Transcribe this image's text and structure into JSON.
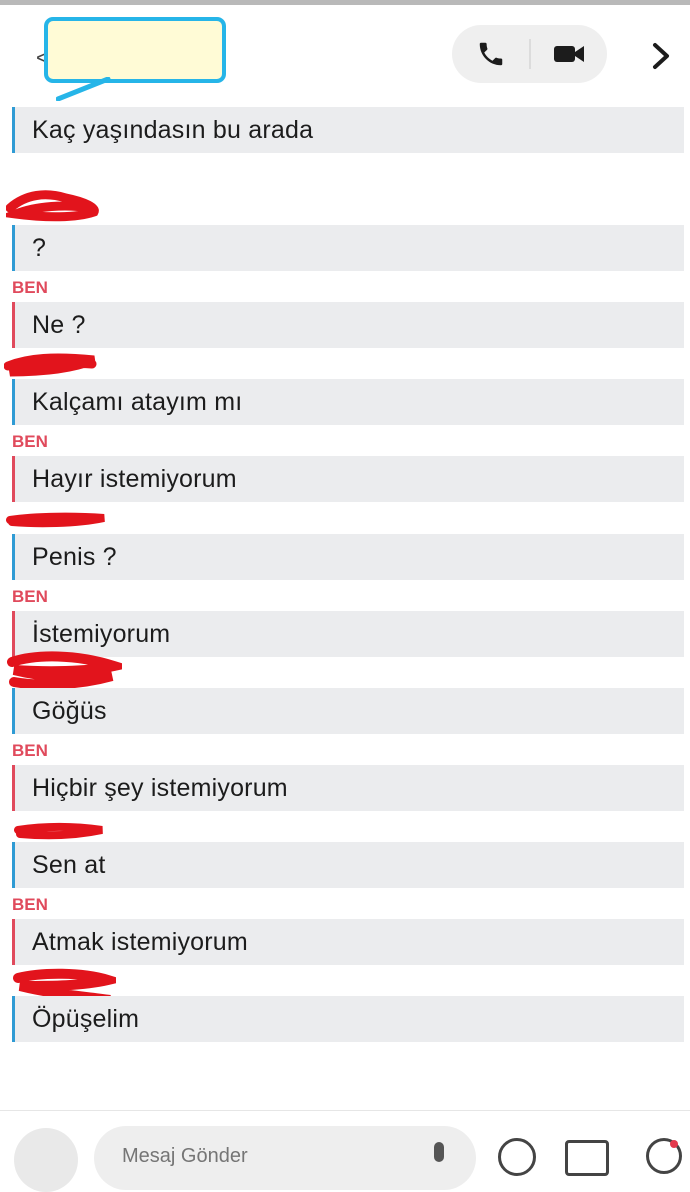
{
  "header": {
    "back_glyph": "<",
    "call_icon": "phone-icon",
    "video_icon": "video-camera-icon",
    "next_icon": "chevron-right-icon"
  },
  "colors": {
    "friend_accent": "#2f9bd4",
    "me_accent": "#e04a5c",
    "bubble_bg": "#ebecee",
    "redaction": "#e2141c",
    "name_box_border": "#26b5e8",
    "name_box_fill": "#fffbd6"
  },
  "messages": [
    {
      "from": "friend",
      "sender_label": "",
      "text": "Kaç yaşındasın bu arada"
    },
    {
      "from": "friend",
      "sender_label": "",
      "text": "?"
    },
    {
      "from": "me",
      "sender_label": "BEN",
      "text": "Ne  ?"
    },
    {
      "from": "friend",
      "sender_label": "",
      "text": "Kalçamı atayım mı"
    },
    {
      "from": "me",
      "sender_label": "BEN",
      "text": "Hayır istemiyorum"
    },
    {
      "from": "friend",
      "sender_label": "",
      "text": "Penis ?"
    },
    {
      "from": "me",
      "sender_label": "BEN",
      "text": "İstemiyorum"
    },
    {
      "from": "friend",
      "sender_label": "",
      "text": "Göğüs"
    },
    {
      "from": "me",
      "sender_label": "BEN",
      "text": "Hiçbir şey istemiyorum"
    },
    {
      "from": "friend",
      "sender_label": "",
      "text": "Sen at"
    },
    {
      "from": "me",
      "sender_label": "BEN",
      "text": "Atmak istemiyorum"
    },
    {
      "from": "friend",
      "sender_label": "",
      "text": "Öpüşelim"
    }
  ],
  "composer": {
    "placeholder": "Mesaj Gönder",
    "camera_icon": "camera-icon",
    "mic_icon": "microphone-icon",
    "emoji_icon": "emoji-icon",
    "sticker_icon": "sticker-icon",
    "games_icon": "rocket-icon"
  }
}
